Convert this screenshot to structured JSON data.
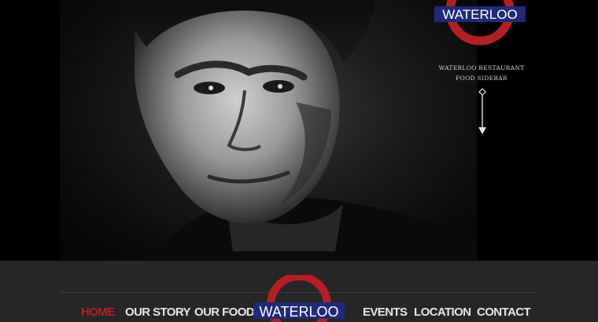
{
  "brand": {
    "name": "WATERLOO",
    "colors": {
      "ring": "#b51f24",
      "bar": "#1f2a7a",
      "text": "#ffffff"
    }
  },
  "sidebar": {
    "text": "WATERLOO RESTAURANT FOOD SIDEBAR",
    "arrow_icon": "down-arrow-icon"
  },
  "hero": {
    "image": "black-and-white-portrait-photo"
  },
  "nav": {
    "items": [
      {
        "label": "HOME",
        "active": true
      },
      {
        "label": "OUR STORY",
        "active": false
      },
      {
        "label": "OUR FOOD",
        "active": false
      },
      {
        "label": "EVENTS",
        "active": false
      },
      {
        "label": "LOCATION",
        "active": false
      },
      {
        "label": "CONTACT",
        "active": false
      }
    ],
    "logo_text": "WATERLOO",
    "active_color": "#b51f24"
  }
}
